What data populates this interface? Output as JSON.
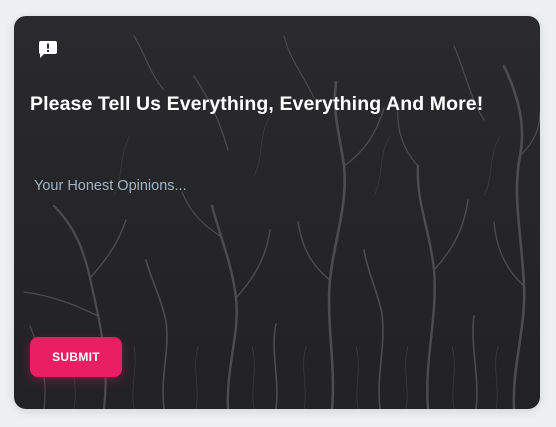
{
  "feedback_card": {
    "icon": "feedback-icon",
    "title": "Please Tell Us Everything, Everything And More!",
    "input": {
      "placeholder": "Your Honest Opinions...",
      "value": ""
    },
    "submit_label": "SUBMIT"
  },
  "colors": {
    "page_background": "#eef0f4",
    "card_background": "#2a2a2c",
    "accent": "#e91e63",
    "title_text": "#ffffff",
    "placeholder_text": "#9fb6c8"
  }
}
